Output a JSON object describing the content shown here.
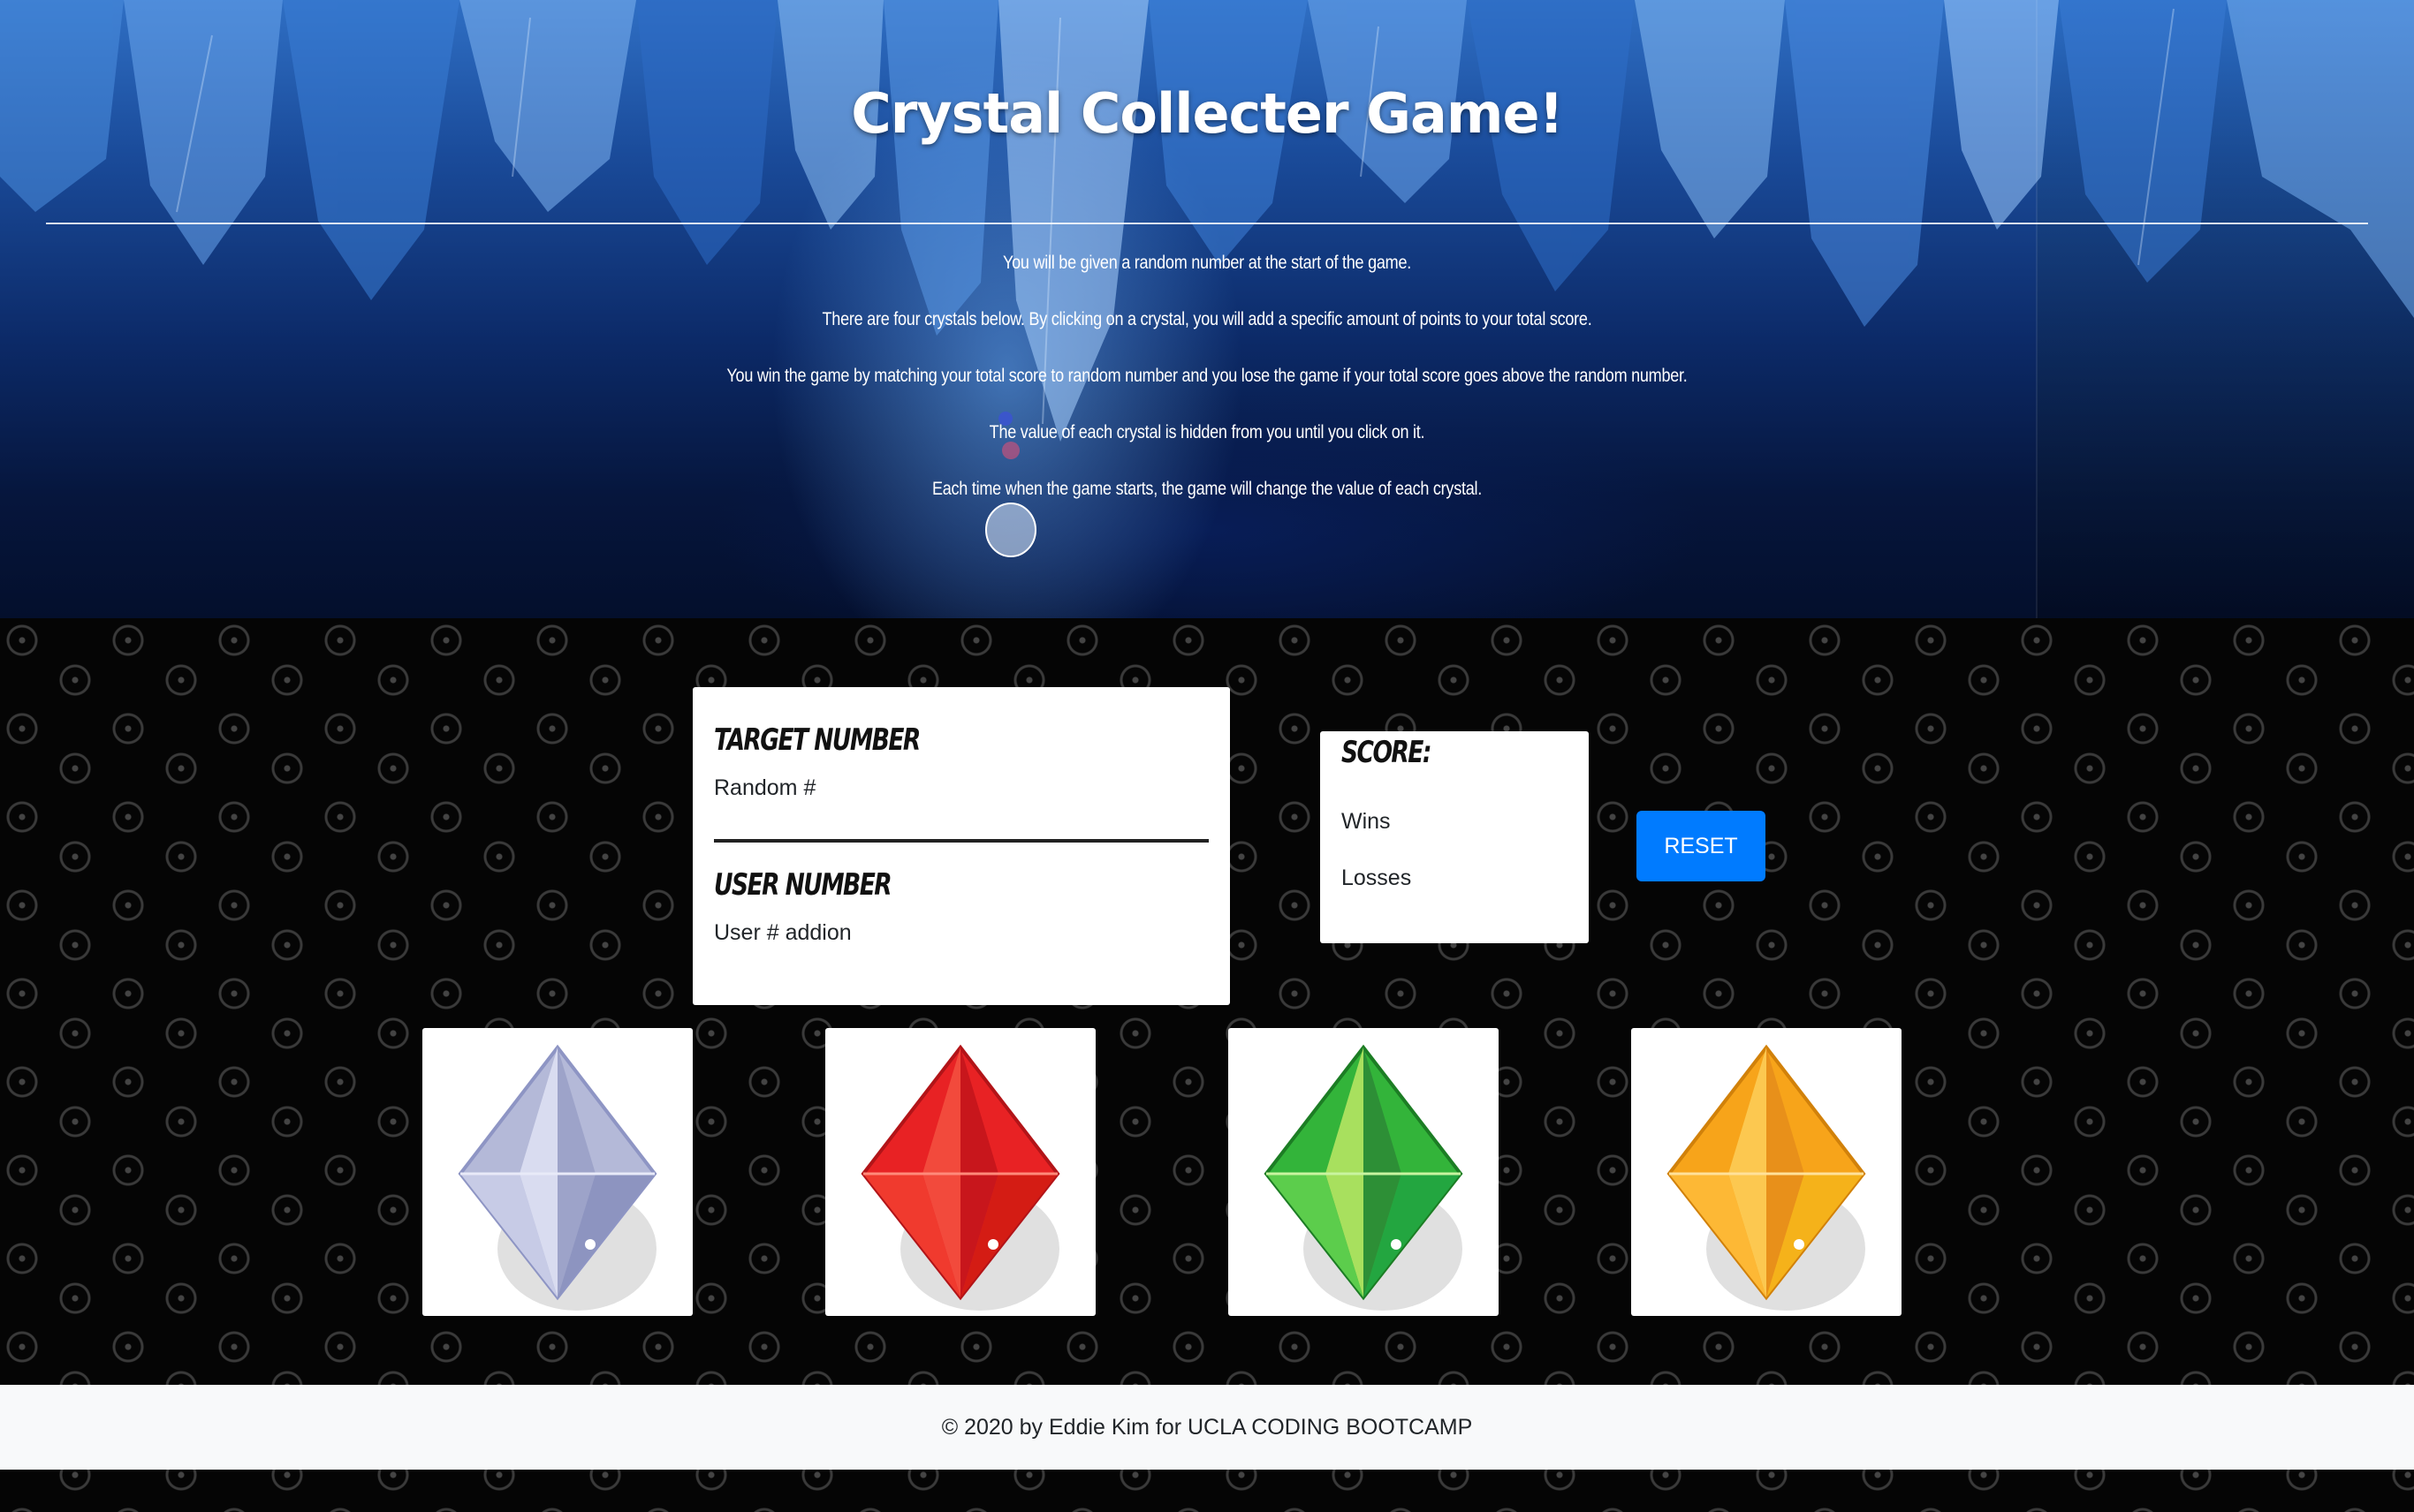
{
  "header": {
    "title": "Crystal Collecter Game!"
  },
  "instructions": [
    "You will be given a random number at the start of the game.",
    "There are four crystals below. By clicking on a crystal, you will add a specific amount of points to your total score.",
    "You win the game by matching your total score to random number and you lose the game if your total score goes above the random number.",
    "The value of each crystal is hidden from you until you click on it.",
    "Each time when the game starts, the game will change the value of each crystal."
  ],
  "target": {
    "heading": "TARGET NUMBER",
    "value": "Random #"
  },
  "user": {
    "heading": "USER NUMBER",
    "value": "User # addion"
  },
  "score": {
    "heading": "SCORE:",
    "wins_label": "Wins",
    "losses_label": "Losses"
  },
  "controls": {
    "reset_label": "RESET",
    "reset_color": "#007bff"
  },
  "crystals": [
    {
      "icon": "silver-crystal-icon",
      "color": "#b4b9d8"
    },
    {
      "icon": "red-crystal-icon",
      "color": "#e82224"
    },
    {
      "icon": "green-crystal-icon",
      "color": "#33b43a"
    },
    {
      "icon": "orange-crystal-icon",
      "color": "#f7a41a"
    }
  ],
  "footer": {
    "text": "© 2020 by Eddie Kim for UCLA CODING BOOTCAMP"
  }
}
